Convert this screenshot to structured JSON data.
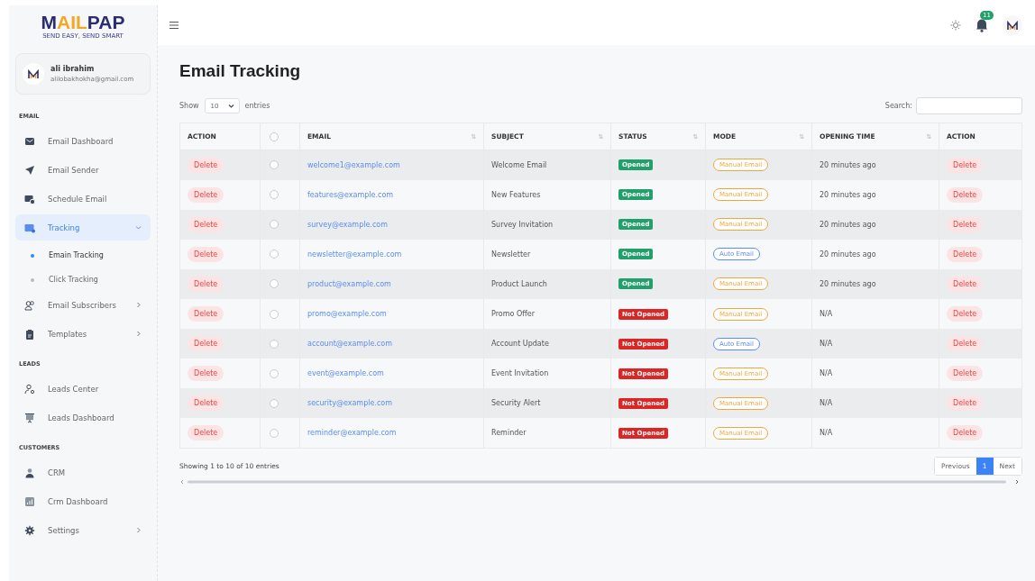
{
  "logo": {
    "parts": [
      {
        "text": "M",
        "color": "#2b2d6e"
      },
      {
        "text": "AIL",
        "color": "#f5a623"
      },
      {
        "text": "PAP",
        "color": "#2b2d6e"
      }
    ],
    "tagline": "SEND EASY, SEND SMART"
  },
  "user": {
    "name": "ali ibrahim",
    "email": "alilobakhokha@gmail.com"
  },
  "sidebar": {
    "sections": [
      {
        "title": "EMAIL",
        "items": [
          {
            "label": "Email Dashboard",
            "selected": false
          },
          {
            "label": "Email Sender",
            "selected": false
          },
          {
            "label": "Schedule Email",
            "selected": false
          },
          {
            "label": "Tracking",
            "selected": true,
            "expanded": true,
            "children": [
              {
                "label": "Emain Tracking",
                "selected": true
              },
              {
                "label": "Click Tracking",
                "selected": false
              }
            ]
          },
          {
            "label": "Email Subscribers",
            "selected": false,
            "expanded": false
          },
          {
            "label": "Templates",
            "selected": false,
            "expanded": false
          }
        ]
      },
      {
        "title": "LEADS",
        "items": [
          {
            "label": "Leads Center",
            "selected": false
          },
          {
            "label": "Leads Dashboard",
            "selected": false
          }
        ]
      },
      {
        "title": "CUSTOMERS",
        "items": [
          {
            "label": "CRM",
            "selected": false
          },
          {
            "label": "Crm Dashboard",
            "selected": false
          },
          {
            "label": "Settings",
            "selected": false,
            "expanded": false
          }
        ]
      }
    ]
  },
  "topbar": {
    "notification_count": "11"
  },
  "page_title": "Email Tracking",
  "length_control": {
    "before": "Show",
    "value": "10",
    "after": "entries"
  },
  "search": {
    "label": "Search:"
  },
  "table": {
    "columns": [
      {
        "label": "ACTION",
        "kind": "text"
      },
      {
        "kind": "checkbox",
        "checked": false
      },
      {
        "label": "EMAIL",
        "kind": "text",
        "sort_icon": "⇅"
      },
      {
        "label": "SUBJECT",
        "kind": "text",
        "sort_icon": "⇅"
      },
      {
        "label": "STATUS",
        "kind": "text",
        "sort_icon": "⇅"
      },
      {
        "label": "MODE",
        "kind": "text",
        "sort_icon": "⇅"
      },
      {
        "label": "OPENING TIME",
        "kind": "text",
        "sort_icon": "⇅"
      },
      {
        "label": "ACTION",
        "kind": "text"
      }
    ],
    "rows": [
      {
        "action": "Delete",
        "checked": false,
        "email": "welcome1@example.com",
        "subject": "Welcome Email",
        "status": {
          "text": "Opened",
          "kind": "opened"
        },
        "mode": {
          "text": "Manual Email",
          "kind": "manual"
        },
        "opening_time": "20 minutes ago",
        "action_2": "Delete"
      },
      {
        "action": "Delete",
        "checked": false,
        "email": "features@example.com",
        "subject": "New Features",
        "status": {
          "text": "Opened",
          "kind": "opened"
        },
        "mode": {
          "text": "Manual Email",
          "kind": "manual"
        },
        "opening_time": "20 minutes ago",
        "action_2": "Delete"
      },
      {
        "action": "Delete",
        "checked": false,
        "email": "survey@example.com",
        "subject": "Survey Invitation",
        "status": {
          "text": "Opened",
          "kind": "opened"
        },
        "mode": {
          "text": "Manual Email",
          "kind": "manual"
        },
        "opening_time": "20 minutes ago",
        "action_2": "Delete"
      },
      {
        "action": "Delete",
        "checked": false,
        "email": "newsletter@example.com",
        "subject": "Newsletter",
        "status": {
          "text": "Opened",
          "kind": "opened"
        },
        "mode": {
          "text": "Auto Email",
          "kind": "auto"
        },
        "opening_time": "20 minutes ago",
        "action_2": "Delete"
      },
      {
        "action": "Delete",
        "checked": false,
        "email": "product@example.com",
        "subject": "Product Launch",
        "status": {
          "text": "Opened",
          "kind": "opened"
        },
        "mode": {
          "text": "Manual Email",
          "kind": "manual"
        },
        "opening_time": "20 minutes ago",
        "action_2": "Delete"
      },
      {
        "action": "Delete",
        "checked": false,
        "email": "promo@example.com",
        "subject": "Promo Offer",
        "status": {
          "text": "Not Opened",
          "kind": "not_opened"
        },
        "mode": {
          "text": "Manual Email",
          "kind": "manual"
        },
        "opening_time": "N/A",
        "action_2": "Delete"
      },
      {
        "action": "Delete",
        "checked": false,
        "email": "account@example.com",
        "subject": "Account Update",
        "status": {
          "text": "Not Opened",
          "kind": "not_opened"
        },
        "mode": {
          "text": "Auto Email",
          "kind": "auto"
        },
        "opening_time": "N/A",
        "action_2": "Delete"
      },
      {
        "action": "Delete",
        "checked": false,
        "email": "event@example.com",
        "subject": "Event Invitation",
        "status": {
          "text": "Not Opened",
          "kind": "not_opened"
        },
        "mode": {
          "text": "Manual Email",
          "kind": "manual"
        },
        "opening_time": "N/A",
        "action_2": "Delete"
      },
      {
        "action": "Delete",
        "checked": false,
        "email": "security@example.com",
        "subject": "Security Alert",
        "status": {
          "text": "Not Opened",
          "kind": "not_opened"
        },
        "mode": {
          "text": "Manual Email",
          "kind": "manual"
        },
        "opening_time": "N/A",
        "action_2": "Delete"
      },
      {
        "action": "Delete",
        "checked": false,
        "email": "reminder@example.com",
        "subject": "Reminder",
        "status": {
          "text": "Not Opened",
          "kind": "not_opened"
        },
        "mode": {
          "text": "Manual Email",
          "kind": "manual"
        },
        "opening_time": "N/A",
        "action_2": "Delete"
      }
    ]
  },
  "info": "Showing 1 to 10 of 10 entries",
  "pagination": [
    {
      "label": "Previous",
      "selected": false
    },
    {
      "label": "1",
      "selected": true
    },
    {
      "label": "Next",
      "selected": false
    }
  ]
}
